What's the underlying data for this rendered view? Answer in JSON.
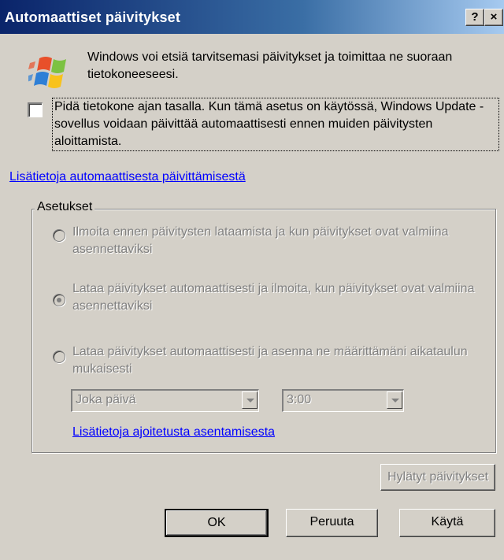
{
  "window": {
    "title": "Automaattiset päivitykset",
    "help_button": "?",
    "close_button": "×"
  },
  "intro": {
    "icon": "windows-logo-icon",
    "text": "Windows voi etsiä tarvitsemasi päivitykset ja toimittaa ne suoraan tietokoneeseesi."
  },
  "keep_updated": {
    "checked": false,
    "label": "Pidä tietokone ajan tasalla. Kun tämä asetus on käytössä, Windows Update -sovellus voidaan päivittää automaattisesti ennen muiden päivitysten aloittamista."
  },
  "learn_more_link": "Lisätietoja automaattisesta päivittämisestä",
  "settings": {
    "group_label": "Asetukset",
    "options": [
      {
        "label": "Ilmoita ennen päivitysten lataamista ja kun päivitykset ovat valmiina asennettaviksi",
        "selected": false
      },
      {
        "label": "Lataa päivitykset automaattisesti ja ilmoita, kun päivitykset ovat valmiina asennettaviksi",
        "selected": true
      },
      {
        "label": "Lataa päivitykset automaattisesti ja asenna ne määrittämäni aikataulun mukaisesti",
        "selected": false
      }
    ],
    "day_select": "Joka päivä",
    "time_select": "3:00",
    "schedule_link": "Lisätietoja ajoitetusta asentamisesta"
  },
  "buttons": {
    "declined": "Hylätyt päivitykset",
    "ok": "OK",
    "cancel": "Peruuta",
    "apply": "Käytä"
  },
  "colors": {
    "titlebar_start": "#0a246a",
    "titlebar_end": "#a6caf0",
    "dialog_bg": "#d4d0c8",
    "link": "#0000ff",
    "disabled_text": "#808080"
  }
}
